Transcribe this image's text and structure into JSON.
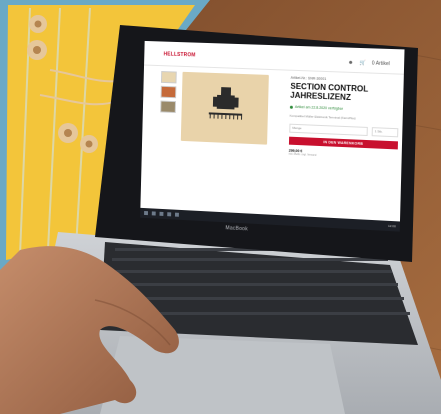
{
  "site": {
    "logo": "HELLSTROM",
    "header_icons": [
      "user-icon",
      "cart-icon"
    ],
    "header_text": "0 Artikel"
  },
  "product": {
    "sku": "Artikel-Nr.: SNR-30001",
    "title": "SECTION CONTROL JAHRESLIZENZ",
    "stock": "Artikel am 22.8.2020 verfügbar",
    "note": "Kompatibel Müller Elektronik Terminal (FarmPilot)",
    "qty_label": "Menge",
    "qty_value": "1 Stk.",
    "cart_button": "IN DEN WARENKORB",
    "price": "299,00 €",
    "price_sub": "inkl. MwSt. zzgl. Versand"
  },
  "taskbar": {
    "clock": "12:00"
  },
  "laptop": {
    "brand": "MacBook"
  },
  "colors": {
    "accent": "#c8102e",
    "wood": "#8b5a35",
    "tablecloth_yellow": "#f3c53a",
    "tablecloth_blue": "#6aa9c6"
  }
}
